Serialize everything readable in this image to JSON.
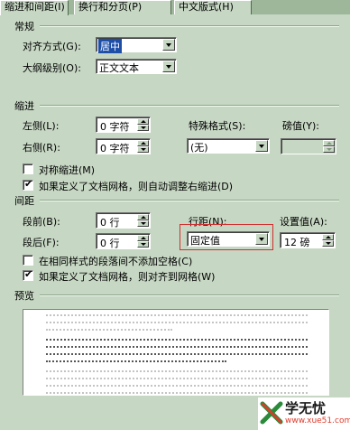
{
  "tabs": [
    {
      "label": "缩进和间距(I)"
    },
    {
      "label": "换行和分页(P)"
    },
    {
      "label": "中文版式(H)"
    }
  ],
  "general": {
    "title": "常规",
    "alignment_label": "对齐方式(G):",
    "alignment_value": "居中",
    "outline_label": "大纲级别(O):",
    "outline_value": "正文文本"
  },
  "indent": {
    "title": "缩进",
    "left_label": "左侧(L):",
    "left_value": "0 字符",
    "right_label": "右侧(R):",
    "right_value": "0 字符",
    "special_label": "特殊格式(S):",
    "special_value": "(无)",
    "by_label": "磅值(Y):",
    "by_value": "",
    "mirror_label": "对称缩进(M)",
    "mirror_checked": false,
    "auto_adjust_label": "如果定义了文档网格，则自动调整右缩进(D)",
    "auto_adjust_checked": true
  },
  "spacing": {
    "title": "间距",
    "before_label": "段前(B):",
    "before_value": "0 行",
    "after_label": "段后(F):",
    "after_value": "0 行",
    "line_spacing_label": "行距(N):",
    "line_spacing_value": "固定值",
    "at_label": "设置值(A):",
    "at_value": "12 磅",
    "no_space_label": "在相同样式的段落间不添加空格(C)",
    "no_space_checked": false,
    "snap_grid_label": "如果定义了文档网格，则对齐到网格(W)",
    "snap_grid_checked": true
  },
  "preview": {
    "title": "预览",
    "before_lines": 3,
    "sample_lines": 4,
    "after_lines": 5
  },
  "watermark": {
    "brand": "学无忧",
    "site": "www.xue51.com"
  }
}
